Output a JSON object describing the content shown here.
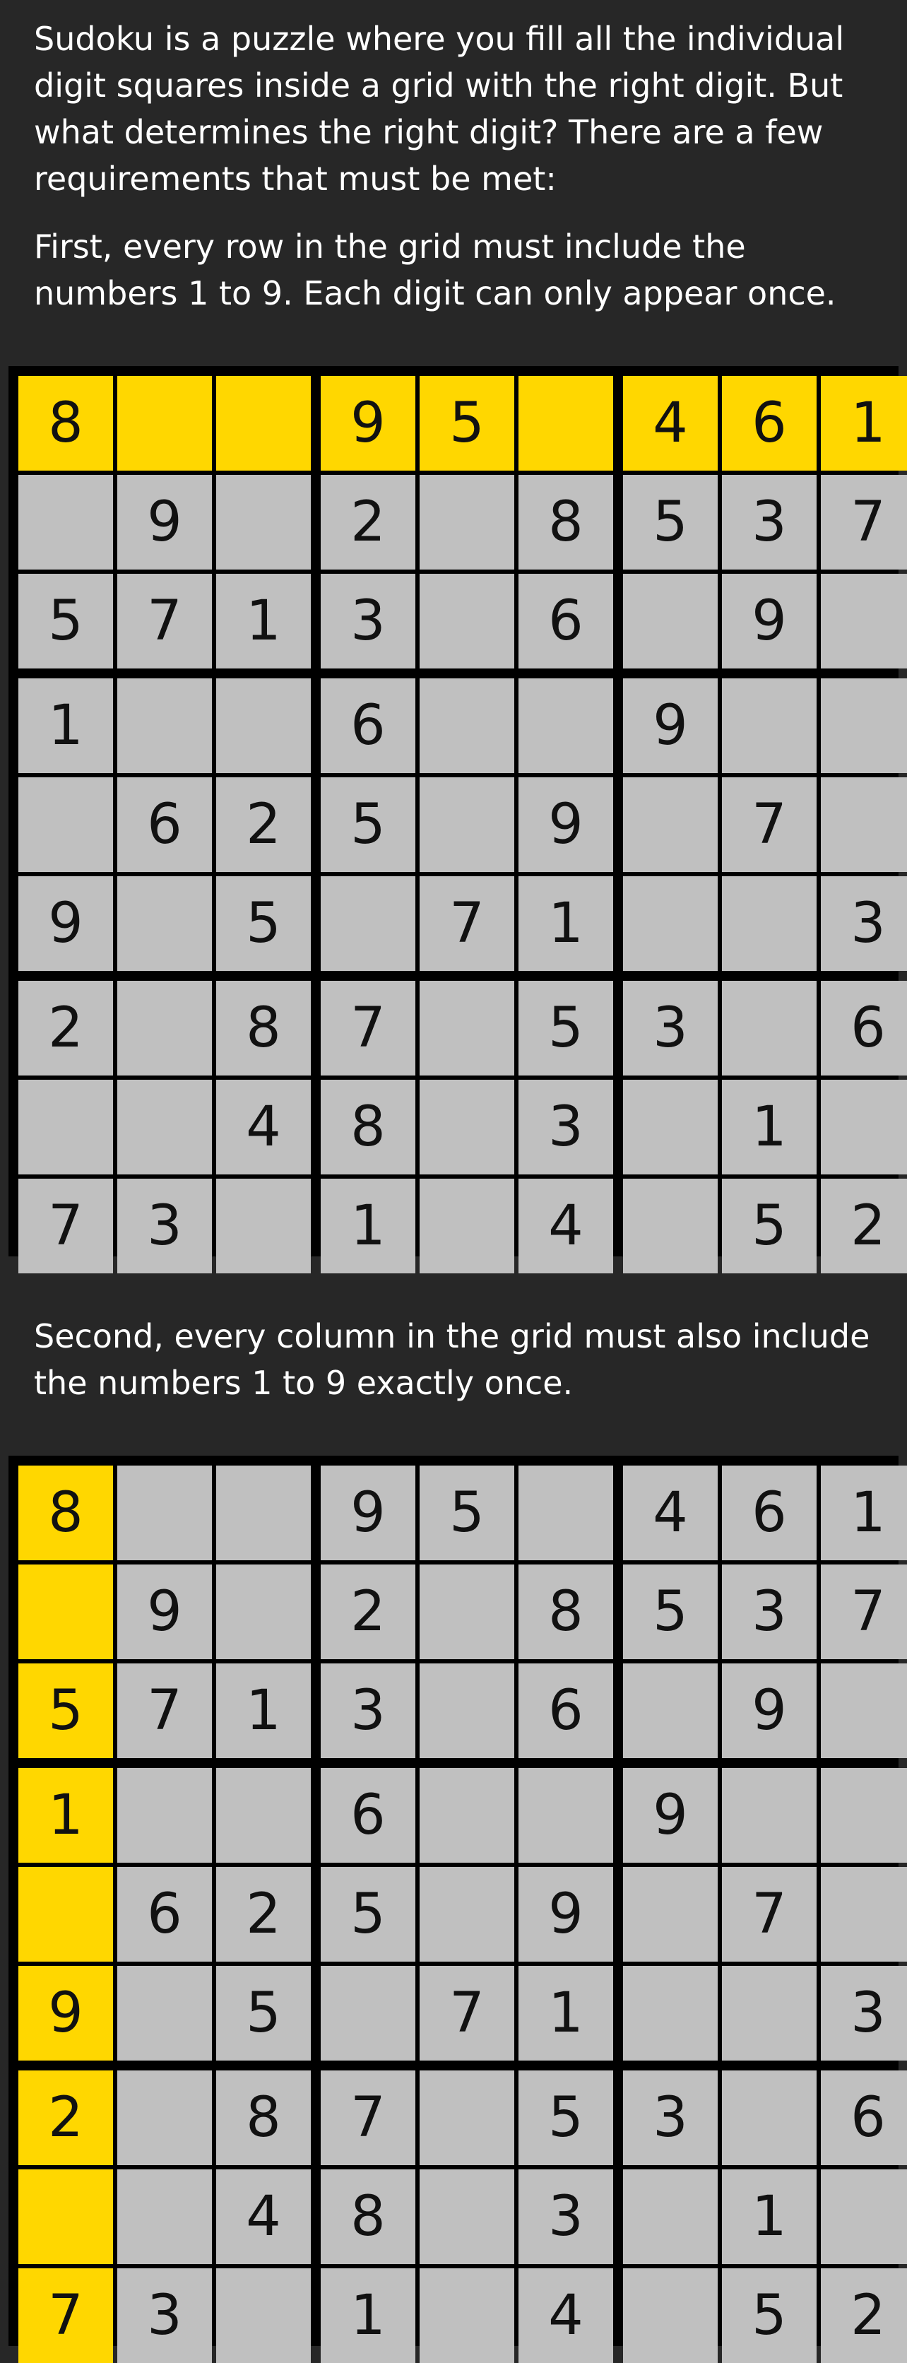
{
  "intro_text": "Sudoku is a puzzle where you fill all the individual digit squares inside a grid with the right digit. But what determines the right digit? There are a few requirements that must be met:",
  "rule_row_text": "First, every row in the grid must include the numbers 1 to 9. Each digit can only appear once.",
  "rule_column_text": "Second, every column in the grid must also include the numbers 1 to 9 exactly once.",
  "colors": {
    "background": "#272727",
    "cell": "#c0c0c0",
    "highlight": "#ffd700",
    "grid": "#000000"
  },
  "grid": [
    [
      "8",
      "",
      "",
      "9",
      "5",
      "",
      "4",
      "6",
      "1"
    ],
    [
      "",
      "9",
      "",
      "2",
      "",
      "8",
      "5",
      "3",
      "7"
    ],
    [
      "5",
      "7",
      "1",
      "3",
      "",
      "6",
      "",
      "9",
      ""
    ],
    [
      "1",
      "",
      "",
      "6",
      "",
      "",
      "9",
      "",
      ""
    ],
    [
      "",
      "6",
      "2",
      "5",
      "",
      "9",
      "",
      "7",
      ""
    ],
    [
      "9",
      "",
      "5",
      "",
      "7",
      "1",
      "",
      "",
      "3"
    ],
    [
      "2",
      "",
      "8",
      "7",
      "",
      "5",
      "3",
      "",
      "6"
    ],
    [
      "",
      "",
      "4",
      "8",
      "",
      "3",
      "",
      "1",
      ""
    ],
    [
      "7",
      "3",
      "",
      "1",
      "",
      "4",
      "",
      "5",
      "2"
    ]
  ],
  "boards": [
    {
      "name": "row-example-grid",
      "highlight": "row",
      "index": 0
    },
    {
      "name": "column-example-grid",
      "highlight": "column",
      "index": 0
    }
  ]
}
